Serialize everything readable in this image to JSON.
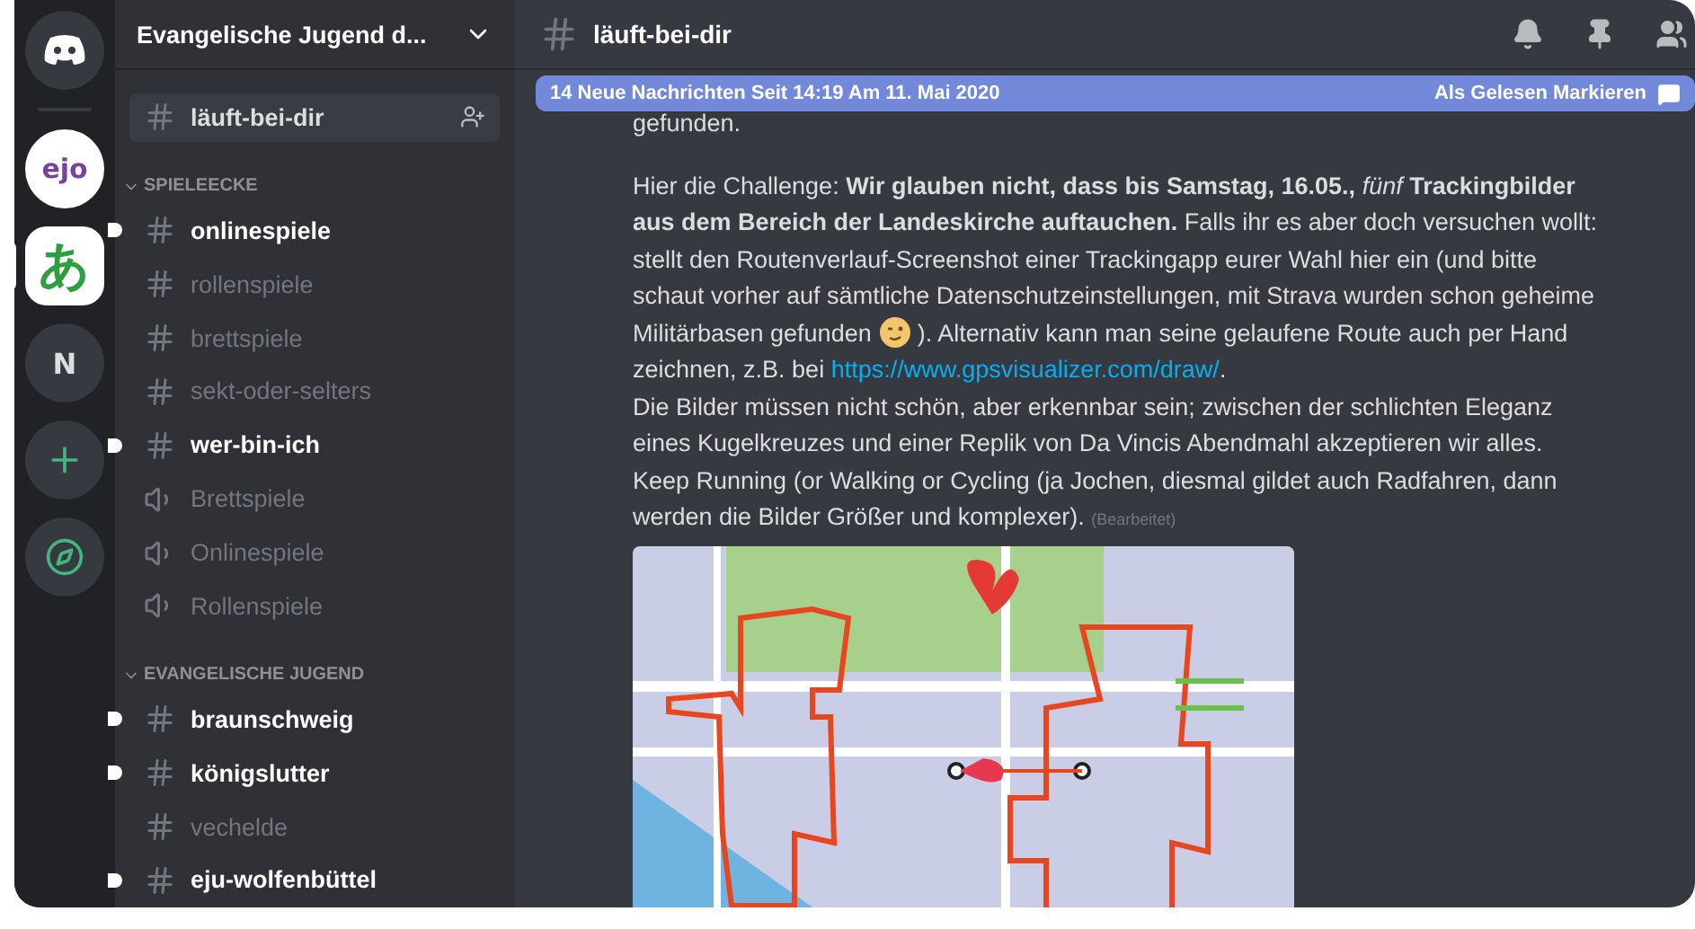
{
  "servers": [
    {
      "kind": "home",
      "selected": false
    },
    {
      "kind": "logo",
      "label": "ejo",
      "selected": false
    },
    {
      "kind": "logo",
      "label": "あ",
      "selected": true
    },
    {
      "kind": "letter",
      "label": "N",
      "selected": false
    },
    {
      "kind": "add",
      "selected": false
    },
    {
      "kind": "explore",
      "selected": false
    }
  ],
  "server_name": "Evangelische Jugend d...",
  "channel_groups": [
    {
      "channels": [
        {
          "kind": "text",
          "name": "läuft-bei-dir",
          "selected": true,
          "unread": false
        }
      ]
    },
    {
      "title": "SPIELEECKE",
      "channels": [
        {
          "kind": "text",
          "name": "onlinespiele",
          "selected": false,
          "unread": true
        },
        {
          "kind": "text",
          "name": "rollenspiele",
          "selected": false,
          "unread": false
        },
        {
          "kind": "text",
          "name": "brettspiele",
          "selected": false,
          "unread": false
        },
        {
          "kind": "text",
          "name": "sekt-oder-selters",
          "selected": false,
          "unread": false
        },
        {
          "kind": "text",
          "name": "wer-bin-ich",
          "selected": false,
          "unread": true
        },
        {
          "kind": "voice",
          "name": "Brettspiele",
          "selected": false,
          "unread": false
        },
        {
          "kind": "voice",
          "name": "Onlinespiele",
          "selected": false,
          "unread": false
        },
        {
          "kind": "voice",
          "name": "Rollenspiele",
          "selected": false,
          "unread": false
        }
      ]
    },
    {
      "title": "EVANGELISCHE JUGEND",
      "channels": [
        {
          "kind": "text",
          "name": "braunschweig",
          "selected": false,
          "unread": true
        },
        {
          "kind": "text",
          "name": "königslutter",
          "selected": false,
          "unread": true
        },
        {
          "kind": "text",
          "name": "vechelde",
          "selected": false,
          "unread": false
        },
        {
          "kind": "text",
          "name": "eju-wolfenbüttel",
          "selected": false,
          "unread": true
        }
      ]
    }
  ],
  "channel_title": "läuft-bei-dir",
  "banner": {
    "text": "14 Neue Nachrichten Seit 14:19 Am 11. Mai 2020",
    "action": "Als Gelesen Markieren"
  },
  "message": {
    "previous_line": "gefunden.",
    "text_before_emoji": "Hier die Challenge: **Wir glauben nicht, dass bis Samstag, 16.05.,** *fünf* **Trackingbilder aus dem Bereich der Landeskirche auftauchen.** Falls ihr es aber doch versuchen wollt: stellt den Routenverlauf-Screenshot einer Trackingapp eurer Wahl hier ein (und bitte schaut vorher auf sämtliche Datenschutzeinstellungen, mit Strava wurden schon geheime Militärbasen gefunden",
    "text_after_emoji": "). Alternativ kann man seine gelaufene Route auch per Hand zeichnen, z.B. bei",
    "link": "https://www.gpsvisualizer.com/draw/",
    "text_after_link": ".",
    "second_paragraph": "Die Bilder müssen nicht schön, aber erkennbar sein; zwischen der schlichten Eleganz eines Kugelkreuzes und einer Replik von Da Vincis Abendmahl akzeptieren wir alles. Keep Running (or Walking or Cycling (ja Jochen, diesmal gildet auch Radfahren, dann werden die Bilder Größer und komplexer).",
    "edited": "(Bearbeitet)"
  }
}
